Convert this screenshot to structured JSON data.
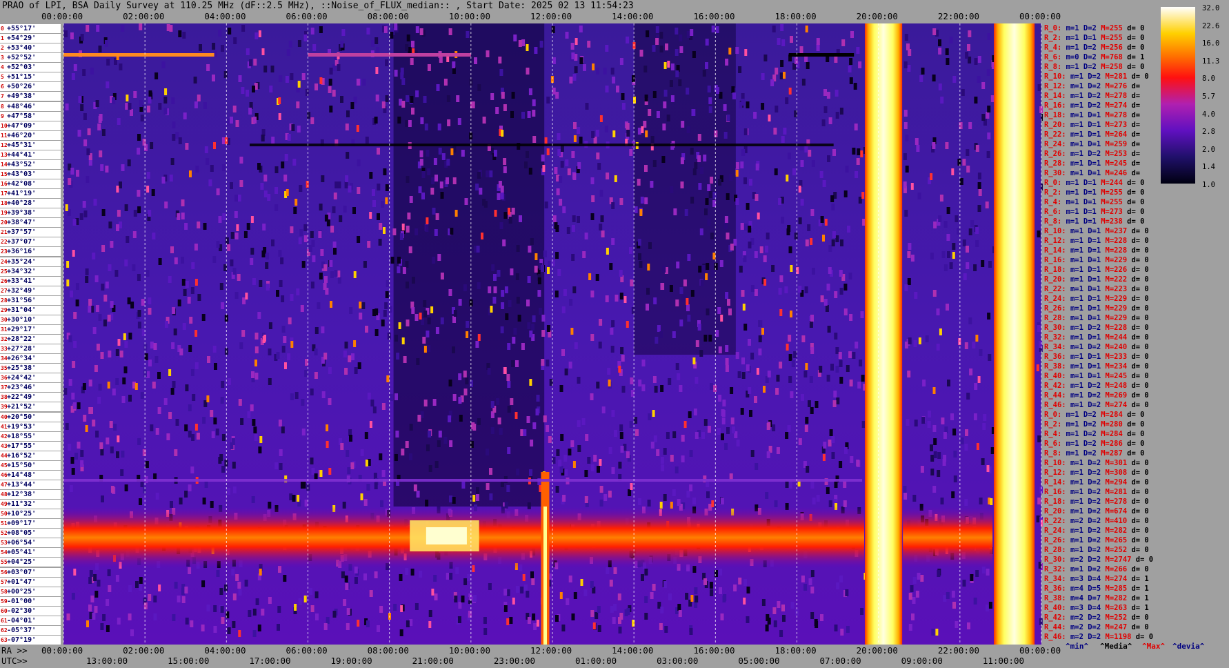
{
  "title": "PRAO of LPI, BSA Daily Survey at 110.25 MHz (dF::2.5 MHz), ::Noise_of_FLUX_median:: , Start Date: 2025 02 13 11:54:23",
  "top_ticks": [
    "00:00:00",
    "02:00:00",
    "04:00:00",
    "06:00:00",
    "08:00:00",
    "10:00:00",
    "12:00:00",
    "14:00:00",
    "16:00:00",
    "18:00:00",
    "20:00:00",
    "22:00:00",
    "00:00:00"
  ],
  "ra_axis_prefix": "RA >>",
  "ra_ticks": [
    "00:00:00",
    "02:00:00",
    "04:00:00",
    "06:00:00",
    "08:00:00",
    "10:00:00",
    "12:00:00",
    "14:00:00",
    "16:00:00",
    "18:00:00",
    "20:00:00",
    "22:00:00",
    "00:00:00"
  ],
  "utc_axis_prefix": "UTC>>",
  "utc_ticks": [
    "13:00:00",
    "15:00:00",
    "17:00:00",
    "19:00:00",
    "21:00:00",
    "23:00:00",
    "01:00:00",
    "03:00:00",
    "05:00:00",
    "07:00:00",
    "09:00:00",
    "11:00:00"
  ],
  "legend": {
    "min": "^min^",
    "median": "^Media^",
    "max": "^Max^",
    "dev": "^devia^"
  },
  "colors": {
    "background": "#a0a0a0",
    "stat_label": "#e00000",
    "stat_value": "#000080"
  },
  "colorbar": {
    "ticks": [
      "32.0",
      "22.6",
      "16.0",
      "11.3",
      "8.0",
      "5.7",
      "4.0",
      "2.8",
      "2.0",
      "1.4",
      "1.0"
    ],
    "scale": "log"
  },
  "chart_data": {
    "type": "heatmap",
    "title": "PRAO of LPI, BSA Daily Survey at 110.25 MHz (dF::2.5 MHz), ::Noise_of_FLUX_median:: , Start Date: 2025 02 13 11:54:23",
    "x_axis": "RA 00:00:00 to 24:00:00 (UTC 11:54:23 to 11:54:23 next day)",
    "y_labels": [
      "+55°17'",
      "+54°29'",
      "+53°40'",
      "+52°52'",
      "+52°03'",
      "+51°15'",
      "+50°26'",
      "+49°38'",
      "+48°46'",
      "+47°58'",
      "+47°09'",
      "+46°20'",
      "+45°31'",
      "+44°41'",
      "+43°52'",
      "+43°03'",
      "+42°08'",
      "+41°19'",
      "+40°28'",
      "+39°38'",
      "+38°47'",
      "+37°57'",
      "+37°07'",
      "+36°16'",
      "+35°24'",
      "+34°32'",
      "+33°41'",
      "+32°49'",
      "+31°56'",
      "+31°04'",
      "+30°10'",
      "+29°17'",
      "+28°22'",
      "+27°28'",
      "+26°34'",
      "+25°38'",
      "+24°42'",
      "+23°46'",
      "+22°49'",
      "+21°52'",
      "+20°50'",
      "+19°53'",
      "+18°55'",
      "+17°55'",
      "+16°52'",
      "+15°50'",
      "+14°48'",
      "+13°44'",
      "+12°38'",
      "+11°32'",
      "+10°25'",
      "+09°17'",
      "+08°05'",
      "+06°54'",
      "+05°41'",
      "+04°25'",
      "+03°07'",
      "+01°47'",
      "+00°25'",
      "-01°00'",
      "-02°30'",
      "-04°01'",
      "-05°37'",
      "-07°19'"
    ],
    "colorbar_range": [
      1.0,
      32.0
    ],
    "features": [
      {
        "label": "bright band near dec +00°25' to -01°00'",
        "ra_start": "00:00",
        "ra_end": "20:00"
      },
      {
        "label": "saturated vertical band",
        "ra_start": "19:40",
        "ra_end": "20:35"
      },
      {
        "label": "saturated vertical band",
        "ra_start": "22:50",
        "ra_end": "23:50"
      },
      {
        "label": "bright spike near RA 11:50 low dec",
        "ra_start": "11:40",
        "ra_end": "12:00"
      }
    ]
  },
  "stats": [
    {
      "r": "R_0:",
      "m": "m=1",
      "d": "D=2",
      "mx": "M=255",
      "dv": "d= 0"
    },
    {
      "r": "R_2:",
      "m": "m=1",
      "d": "D=1",
      "mx": "M=255",
      "dv": "d= 0"
    },
    {
      "r": "R_4:",
      "m": "m=1",
      "d": "D=2",
      "mx": "M=256",
      "dv": "d= 0"
    },
    {
      "r": "R_6:",
      "m": "m=0",
      "d": "D=2",
      "mx": "M=768",
      "dv": "d= 1"
    },
    {
      "r": "R_8:",
      "m": "m=1",
      "d": "D=2",
      "mx": "M=258",
      "dv": "d= 0"
    },
    {
      "r": "R_10:",
      "m": "m=1",
      "d": "D=2",
      "mx": "M=281",
      "dv": "d= 0"
    },
    {
      "r": "R_12:",
      "m": "m=1",
      "d": "D=2",
      "mx": "M=276",
      "dv": "d="
    },
    {
      "r": "R_14:",
      "m": "m=1",
      "d": "D=2",
      "mx": "M=278",
      "dv": "d="
    },
    {
      "r": "R_16:",
      "m": "m=1",
      "d": "D=2",
      "mx": "M=274",
      "dv": "d="
    },
    {
      "r": "R_18:",
      "m": "m=1",
      "d": "D=1",
      "mx": "M=278",
      "dv": "d="
    },
    {
      "r": "R_20:",
      "m": "m=1",
      "d": "D=1",
      "mx": "M=273",
      "dv": "d="
    },
    {
      "r": "R_22:",
      "m": "m=1",
      "d": "D=1",
      "mx": "M=264",
      "dv": "d="
    },
    {
      "r": "R_24:",
      "m": "m=1",
      "d": "D=1",
      "mx": "M=259",
      "dv": "d="
    },
    {
      "r": "R_26:",
      "m": "m=1",
      "d": "D=2",
      "mx": "M=253",
      "dv": "d="
    },
    {
      "r": "R_28:",
      "m": "m=1",
      "d": "D=1",
      "mx": "M=245",
      "dv": "d="
    },
    {
      "r": "R_30:",
      "m": "m=1",
      "d": "D=1",
      "mx": "M=246",
      "dv": "d="
    },
    {
      "r": "R_0:",
      "m": "m=1",
      "d": "D=1",
      "mx": "M=244",
      "dv": "d= 0"
    },
    {
      "r": "R_2:",
      "m": "m=1",
      "d": "D=1",
      "mx": "M=255",
      "dv": "d= 0"
    },
    {
      "r": "R_4:",
      "m": "m=1",
      "d": "D=1",
      "mx": "M=255",
      "dv": "d= 0"
    },
    {
      "r": "R_6:",
      "m": "m=1",
      "d": "D=1",
      "mx": "M=273",
      "dv": "d= 0"
    },
    {
      "r": "R_8:",
      "m": "m=1",
      "d": "D=1",
      "mx": "M=238",
      "dv": "d= 0"
    },
    {
      "r": "R_10:",
      "m": "m=1",
      "d": "D=1",
      "mx": "M=237",
      "dv": "d= 0"
    },
    {
      "r": "R_12:",
      "m": "m=1",
      "d": "D=1",
      "mx": "M=228",
      "dv": "d= 0"
    },
    {
      "r": "R_14:",
      "m": "m=1",
      "d": "D=1",
      "mx": "M=228",
      "dv": "d= 0"
    },
    {
      "r": "R_16:",
      "m": "m=1",
      "d": "D=1",
      "mx": "M=229",
      "dv": "d= 0"
    },
    {
      "r": "R_18:",
      "m": "m=1",
      "d": "D=1",
      "mx": "M=226",
      "dv": "d= 0"
    },
    {
      "r": "R_20:",
      "m": "m=1",
      "d": "D=1",
      "mx": "M=222",
      "dv": "d= 0"
    },
    {
      "r": "R_22:",
      "m": "m=1",
      "d": "D=1",
      "mx": "M=223",
      "dv": "d= 0"
    },
    {
      "r": "R_24:",
      "m": "m=1",
      "d": "D=1",
      "mx": "M=229",
      "dv": "d= 0"
    },
    {
      "r": "R_26:",
      "m": "m=1",
      "d": "D=1",
      "mx": "M=229",
      "dv": "d= 0"
    },
    {
      "r": "R_28:",
      "m": "m=1",
      "d": "D=1",
      "mx": "M=229",
      "dv": "d= 0"
    },
    {
      "r": "R_30:",
      "m": "m=1",
      "d": "D=2",
      "mx": "M=228",
      "dv": "d= 0"
    },
    {
      "r": "R_32:",
      "m": "m=1",
      "d": "D=1",
      "mx": "M=244",
      "dv": "d= 0"
    },
    {
      "r": "R_34:",
      "m": "m=1",
      "d": "D=2",
      "mx": "M=240",
      "dv": "d= 0"
    },
    {
      "r": "R_36:",
      "m": "m=1",
      "d": "D=1",
      "mx": "M=233",
      "dv": "d= 0"
    },
    {
      "r": "R_38:",
      "m": "m=1",
      "d": "D=1",
      "mx": "M=234",
      "dv": "d= 0"
    },
    {
      "r": "R_40:",
      "m": "m=1",
      "d": "D=1",
      "mx": "M=245",
      "dv": "d= 0"
    },
    {
      "r": "R_42:",
      "m": "m=1",
      "d": "D=2",
      "mx": "M=248",
      "dv": "d= 0"
    },
    {
      "r": "R_44:",
      "m": "m=1",
      "d": "D=2",
      "mx": "M=269",
      "dv": "d= 0"
    },
    {
      "r": "R_46:",
      "m": "m=1",
      "d": "D=2",
      "mx": "M=274",
      "dv": "d= 0"
    },
    {
      "r": "R_0:",
      "m": "m=1",
      "d": "D=2",
      "mx": "M=284",
      "dv": "d= 0"
    },
    {
      "r": "R_2:",
      "m": "m=1",
      "d": "D=2",
      "mx": "M=280",
      "dv": "d= 0"
    },
    {
      "r": "R_4:",
      "m": "m=1",
      "d": "D=2",
      "mx": "M=284",
      "dv": "d= 0"
    },
    {
      "r": "R_6:",
      "m": "m=1",
      "d": "D=2",
      "mx": "M=286",
      "dv": "d= 0"
    },
    {
      "r": "R_8:",
      "m": "m=1",
      "d": "D=2",
      "mx": "M=287",
      "dv": "d= 0"
    },
    {
      "r": "R_10:",
      "m": "m=1",
      "d": "D=2",
      "mx": "M=301",
      "dv": "d= 0"
    },
    {
      "r": "R_12:",
      "m": "m=1",
      "d": "D=2",
      "mx": "M=308",
      "dv": "d= 0"
    },
    {
      "r": "R_14:",
      "m": "m=1",
      "d": "D=2",
      "mx": "M=294",
      "dv": "d= 0"
    },
    {
      "r": "R_16:",
      "m": "m=1",
      "d": "D=2",
      "mx": "M=281",
      "dv": "d= 0"
    },
    {
      "r": "R_18:",
      "m": "m=1",
      "d": "D=2",
      "mx": "M=278",
      "dv": "d= 0"
    },
    {
      "r": "R_20:",
      "m": "m=1",
      "d": "D=2",
      "mx": "M=674",
      "dv": "d= 0"
    },
    {
      "r": "R_22:",
      "m": "m=2",
      "d": "D=2",
      "mx": "M=410",
      "dv": "d= 0"
    },
    {
      "r": "R_24:",
      "m": "m=1",
      "d": "D=2",
      "mx": "M=282",
      "dv": "d= 0"
    },
    {
      "r": "R_26:",
      "m": "m=1",
      "d": "D=2",
      "mx": "M=265",
      "dv": "d= 0"
    },
    {
      "r": "R_28:",
      "m": "m=1",
      "d": "D=2",
      "mx": "M=252",
      "dv": "d= 0"
    },
    {
      "r": "R_30:",
      "m": "m=2",
      "d": "D=2",
      "mx": "M=2747",
      "dv": "d= 0"
    },
    {
      "r": "R_32:",
      "m": "m=1",
      "d": "D=2",
      "mx": "M=266",
      "dv": "d= 0"
    },
    {
      "r": "R_34:",
      "m": "m=3",
      "d": "D=4",
      "mx": "M=274",
      "dv": "d= 1"
    },
    {
      "r": "R_36:",
      "m": "m=4",
      "d": "D=5",
      "mx": "M=285",
      "dv": "d= 1"
    },
    {
      "r": "R_38:",
      "m": "m=4",
      "d": "D=7",
      "mx": "M=282",
      "dv": "d= 1"
    },
    {
      "r": "R_40:",
      "m": "m=3",
      "d": "D=4",
      "mx": "M=263",
      "dv": "d= 1"
    },
    {
      "r": "R_42:",
      "m": "m=2",
      "d": "D=2",
      "mx": "M=252",
      "dv": "d= 0"
    },
    {
      "r": "R_44:",
      "m": "m=2",
      "d": "D=2",
      "mx": "M=247",
      "dv": "d= 0"
    },
    {
      "r": "R_46:",
      "m": "m=2",
      "d": "D=2",
      "mx": "M=1198",
      "dv": "d= 0"
    }
  ]
}
